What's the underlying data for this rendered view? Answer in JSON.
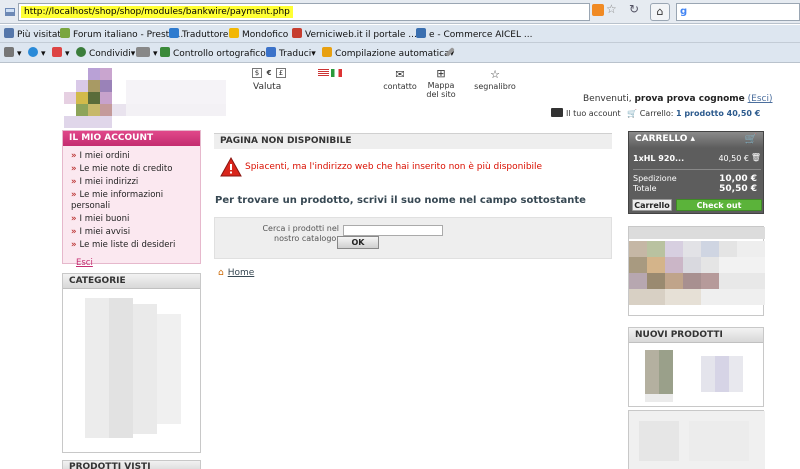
{
  "browser": {
    "url": "http://localhost/shop/shop/modules/bankwire/payment.php",
    "bookmarks": [
      {
        "label": "Più visitati",
        "color": "#5577aa"
      },
      {
        "label": "Forum italiano - Presta...",
        "color": "#7aa640"
      },
      {
        "label": "Traduttore",
        "color": "#2e7bcf"
      },
      {
        "label": "Mondofico",
        "color": "#f2b705"
      },
      {
        "label": "Verniciweb.it il portale ...",
        "color": "#c63d2f"
      },
      {
        "label": "e - Commerce  AICEL ...",
        "color": "#3a6fb0"
      }
    ],
    "toolbar": {
      "share": "Condividi",
      "spell": "Controllo ortografico",
      "translate": "Traduci",
      "autofill": "Compilazione automatica"
    }
  },
  "header": {
    "currencies": [
      "$",
      "€",
      "£"
    ],
    "currency_label": "Valuta",
    "contact": "contatto",
    "sitemap": "Mappa del sito",
    "bookmark": "segnalibro",
    "welcome_prefix": "Benvenuti,",
    "user_name": "prova prova cognome",
    "logout": "(Esci)",
    "your_account": "Il tuo account",
    "cart_prefix": "Carrello:",
    "cart_summary": "1 prodotto 40,50 €"
  },
  "account": {
    "title": "IL MIO ACCOUNT",
    "items": [
      "I miei ordini",
      "Le mie note di credito",
      "I miei indirizzi",
      "Le mie informazioni personali",
      "I miei buoni",
      "I miei avvisi",
      "Le mie liste di desideri"
    ],
    "logout": "Esci"
  },
  "categories": {
    "title": "CATEGORIE"
  },
  "viewed": {
    "title": "PRODOTTI VISTI"
  },
  "main": {
    "title": "PAGINA NON DISPONIBILE",
    "error": "Spiacenti, ma l'indirizzo web che hai inserito non è più disponibile",
    "find_title": "Per trovare un prodotto, scrivi il suo nome nel campo sottostante",
    "search_label": "Cerca i prodotti nel nostro catalogo:",
    "search_value": "",
    "ok": "OK",
    "home": "Home"
  },
  "cart": {
    "title": "CARRELLO",
    "item_qty_name": "1xHL 920...",
    "item_price": "40,50 €",
    "shipping_label": "Spedizione",
    "shipping_value": "10,00 €",
    "total_label": "Totale",
    "total_value": "50,50 €",
    "cart_button": "Carrello",
    "checkout_button": "Check out"
  },
  "new_products": {
    "title": "NUOVI PRODOTTI"
  }
}
